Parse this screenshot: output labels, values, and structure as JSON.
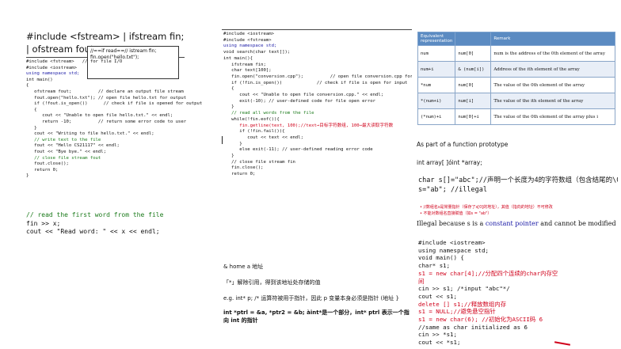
{
  "col1": {
    "title": "#include <fstream> | ifstream fin; | ofstream fout;",
    "note_lines": [
      "//==if read==// istream fin;",
      "fin.open(\"hello.txt\");"
    ],
    "code": [
      "#include <fstream>   // for file I/O",
      "#include <iostream>",
      "",
      "using namespace std;",
      "",
      "int main()",
      "{",
      "   ofstream fout;          // declare an output file stream",
      "",
      "   fout.open(\"hello.txt\"); // open file hello.txt for output",
      "",
      "   if (!fout.is_open())      // check if file is opened for output",
      "   {",
      "      cout << \"Unable to open file hello.txt.\" << endl;",
      "      return -10;          // return some error code to user",
      "   }",
      "   cout << \"Writing to file hello.txt.\" << endl;",
      "",
      "   // write text to the file",
      "   fout << \"Hello CS21117\" << endl;",
      "   fout << \"Bye bye.\" << endl;",
      "",
      "   // close file stream fout",
      "   fout.close();",
      "",
      "   return 0;",
      "}"
    ],
    "big_code": [
      "// read the first word from the file",
      "fin >> x;",
      "cout << \"Read word: \" << x << endl;"
    ]
  },
  "col2": {
    "code": [
      "#include <iostream>",
      "#include <fstream>",
      "",
      "using namespace std;",
      "",
      "void search(char text[]);",
      "",
      "int main(){",
      "   ifstream fin;",
      "   char text[100];",
      "",
      "   fin.open(\"conversion.cpp\");          // open file conversion.cpp for input",
      "",
      "   if (!fin.is_open())             // check if file is open for input",
      "   {",
      "      cout << \"Unable to open file conversion.cpp.\" << endl;",
      "      exit(-10); // user-defined code for file open error",
      "   }",
      "",
      "   // read all words from the file",
      "   while(!fin.eof()){",
      "      fin.getline(text, 100);//text→目标字符数组, 100→最大读取字符数",
      "      if (!fin.fail()){",
      "         cout << text << endl;",
      "      }",
      "      else exit(-11); // user-defined reading error code",
      "   }",
      "",
      "   // close file stream fin",
      "   fin.close();",
      "",
      "   return 0;",
      "}"
    ],
    "notes": [
      "& home a 地址",
      "「*」解除引用，得到该地址处存储的值",
      "e.g. int* p; /* 运算符被用于指针，因此 p 变量本身必须是指针 (地址 }",
      "int *ptrl = &a, *ptr2 = &b; àint*是一个部分，int* ptrl 表示一个指向 int 的指针"
    ]
  },
  "col3": {
    "table": {
      "headers": [
        "Equivalent representation",
        "",
        "Remark"
      ],
      "rows": [
        [
          "num",
          "num[0]",
          "num is the address of the 0th element of the array"
        ],
        [
          "num+i",
          "& (num[i])",
          "Address of the ith element of the array"
        ],
        [
          "*num",
          "num[0]",
          "The value of the 0th element of the array"
        ],
        [
          "*(num+i)",
          "num[i]",
          "The value of the ith element of the array"
        ],
        [
          "(*num)+i",
          "num[0]+i",
          "The value of the 0th element of the array plus i"
        ]
      ]
    },
    "proto_label": "As part of a function prototype",
    "proto_code": "int array[ ]óint *array;",
    "illegal_code": [
      "char s[]=\"abc\";//声明一个长度为4的字符数组（包含结尾的\\0）",
      "s=\"ab\"; //illegal"
    ],
    "bullets": [
      "//数组名s是常量指针（保存了s[0]的地址），其值（指向的地址）不可修改",
      "不能对数组名直接赋值（如s = \"ab\"）"
    ],
    "illegal_text": [
      "Illegal because s is a ",
      "constant pointer",
      " and cannot be modified"
    ],
    "code2": [
      "#include <iostream>",
      "using namespace std;",
      "void main() {",
      "char* s1;",
      "s1 = new char[4];//分配四个连续的char内存空",
      "间",
      "cin >> s1; /*input \"abc\"*/",
      "cout << s1;",
      "delete [] s1;//释放数组内存",
      "s1 = NULL;//避免悬空指针",
      "s1 = new char(6); //初始化为ASCII码 6",
      "//same as char initialized as 6",
      "cin >> *s1;",
      "cout << *s1;"
    ]
  }
}
